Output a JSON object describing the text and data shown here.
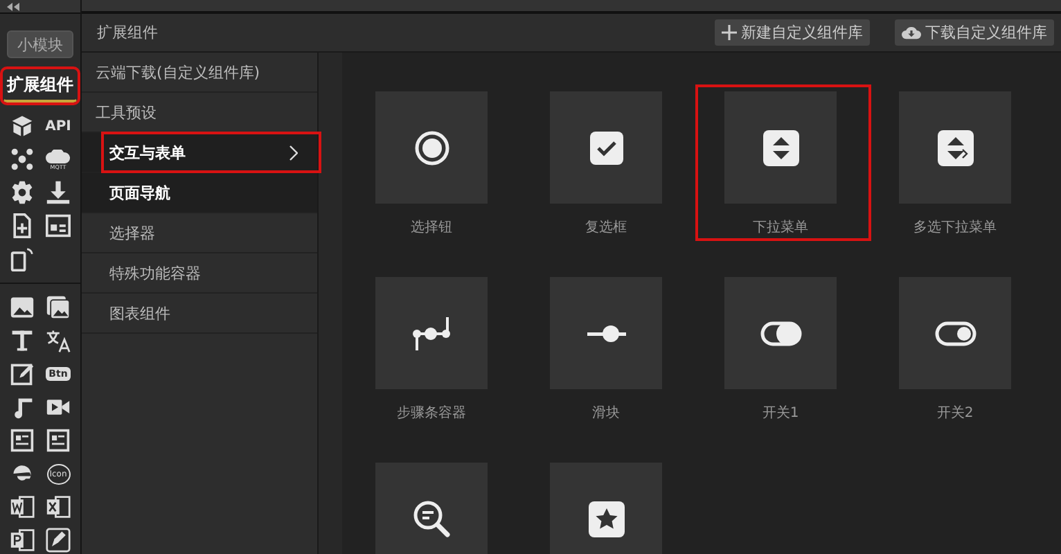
{
  "rail": {
    "module_button": "小模块",
    "tab": {
      "label": "扩展组件",
      "selected": true,
      "highlighted": true
    },
    "icons": [
      {
        "kind": "box"
      },
      {
        "kind": "text",
        "label": "API"
      },
      {
        "kind": "nodes"
      },
      {
        "kind": "cloud",
        "label": "MQTT"
      },
      {
        "kind": "gear"
      },
      {
        "kind": "download"
      },
      {
        "kind": "file"
      },
      {
        "kind": "window"
      },
      {
        "kind": "phone"
      },
      {
        "kind": "divider"
      },
      {
        "kind": "image"
      },
      {
        "kind": "images"
      },
      {
        "kind": "letter"
      },
      {
        "kind": "translate"
      },
      {
        "kind": "edit"
      },
      {
        "kind": "chip",
        "label": "Btn"
      },
      {
        "kind": "music"
      },
      {
        "kind": "video"
      },
      {
        "kind": "doc"
      },
      {
        "kind": "doc"
      },
      {
        "kind": "browser"
      },
      {
        "kind": "ring",
        "label": "Icon"
      },
      {
        "kind": "word"
      },
      {
        "kind": "excel"
      },
      {
        "kind": "slides"
      },
      {
        "kind": "pen"
      }
    ]
  },
  "header": {
    "title": "扩展组件",
    "buttons": [
      {
        "kind": "plus",
        "label": "新建自定义组件库"
      },
      {
        "kind": "cloud",
        "label": "下载自定义组件库"
      }
    ]
  },
  "menu": [
    {
      "label": "云端下载(自定义组件库)",
      "selected": false,
      "hover": false,
      "highlighted": false
    },
    {
      "label": "工具预设",
      "selected": false,
      "hover": false,
      "highlighted": false,
      "children": [
        {
          "label": "交互与表单",
          "selected": true,
          "hover": false,
          "highlighted": true
        },
        {
          "label": "页面导航",
          "selected": false,
          "hover": true,
          "highlighted": false
        },
        {
          "label": "选择器",
          "selected": false,
          "hover": false,
          "highlighted": false
        },
        {
          "label": "特殊功能容器",
          "selected": false,
          "hover": false,
          "highlighted": false
        },
        {
          "label": "图表组件",
          "selected": false,
          "hover": false,
          "highlighted": false
        }
      ]
    }
  ],
  "components": [
    {
      "kind": "radio",
      "label": "选择钮",
      "highlighted": false
    },
    {
      "kind": "checkbox",
      "label": "复选框",
      "highlighted": false
    },
    {
      "kind": "dropdown",
      "label": "下拉菜单",
      "highlighted": true
    },
    {
      "kind": "multi-dropdown",
      "label": "多选下拉菜单",
      "highlighted": false
    },
    {
      "kind": "steps",
      "label": "步骤条容器",
      "highlighted": false
    },
    {
      "kind": "slider",
      "label": "滑块",
      "highlighted": false
    },
    {
      "kind": "switch-left",
      "label": "开关1",
      "highlighted": false
    },
    {
      "kind": "switch-right",
      "label": "开关2",
      "highlighted": false
    },
    {
      "kind": "search",
      "highlighted": false
    },
    {
      "kind": "star",
      "highlighted": false
    }
  ]
}
